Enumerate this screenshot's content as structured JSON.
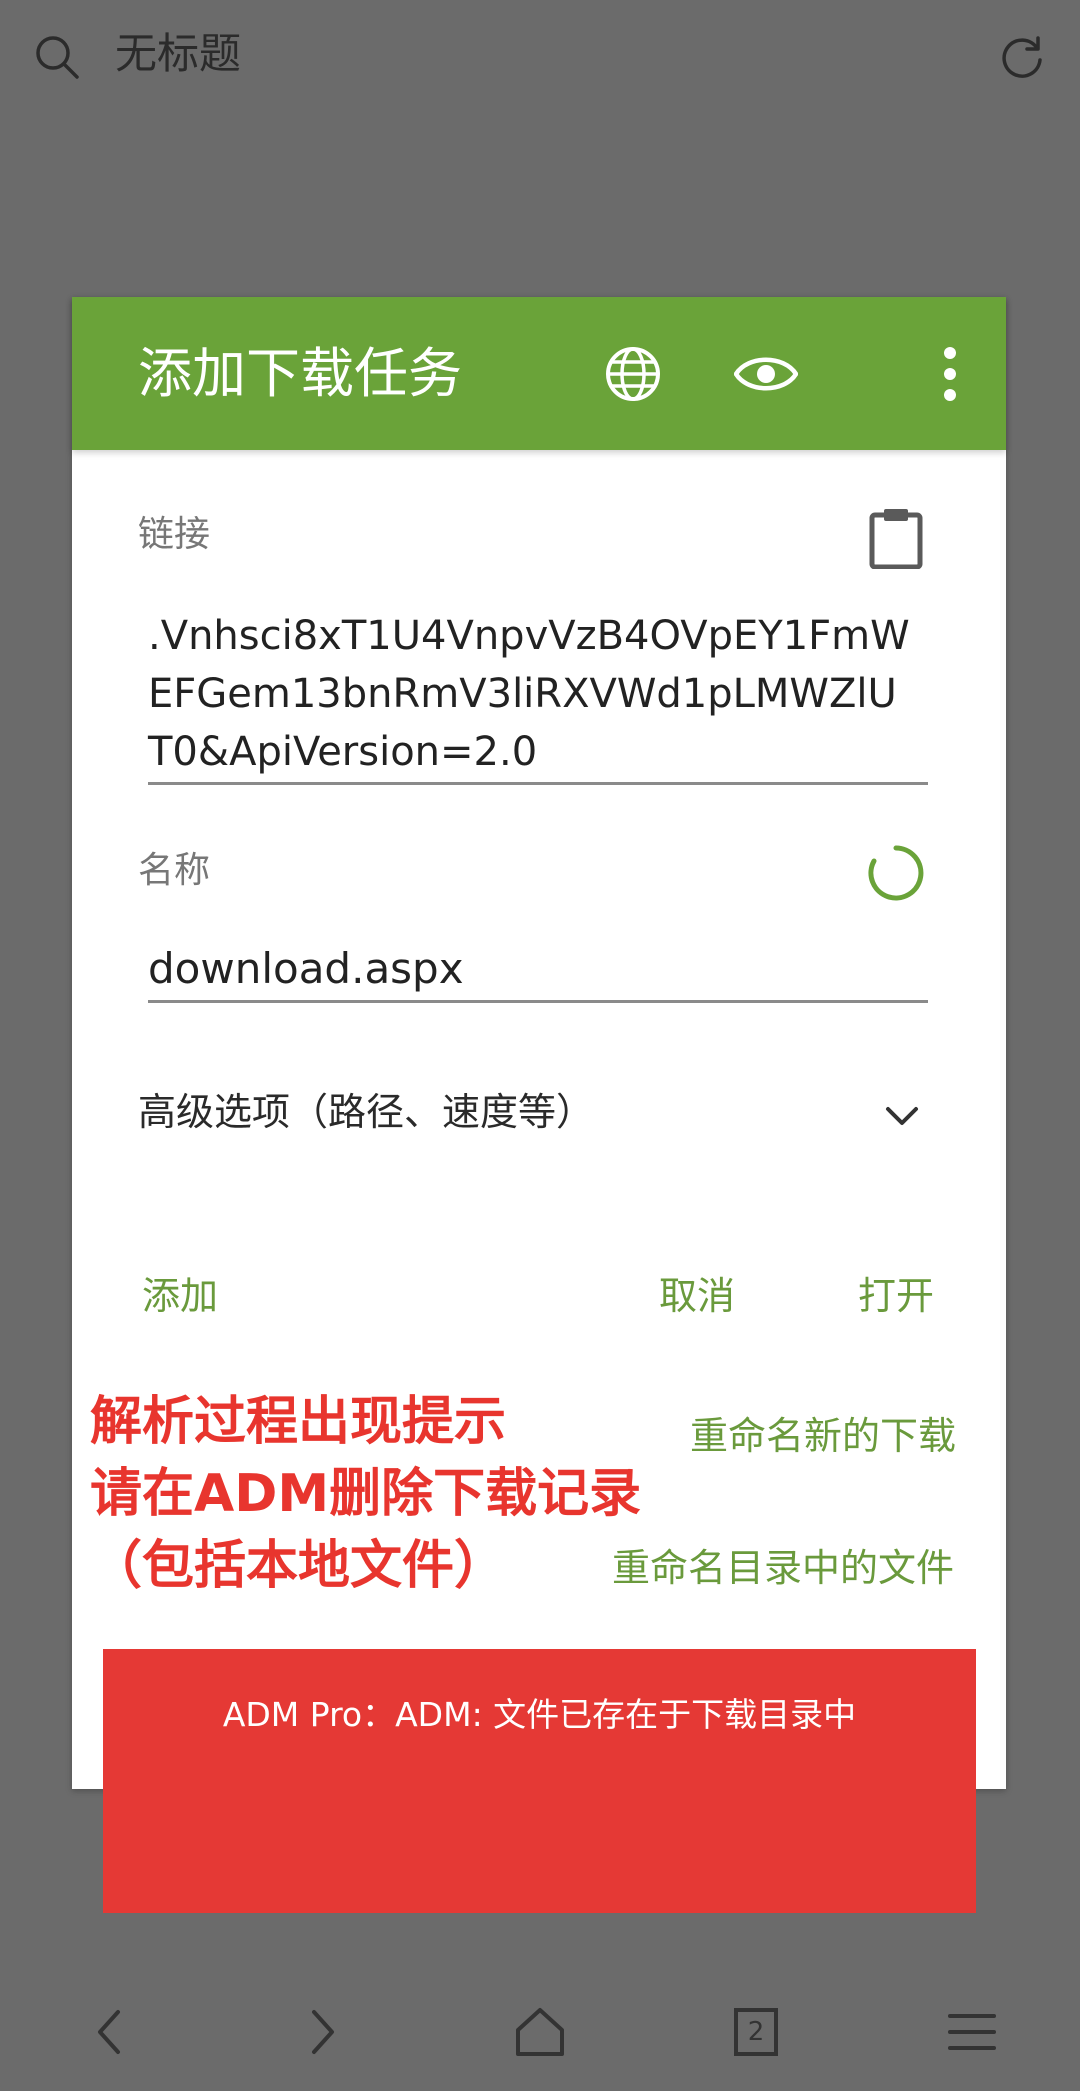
{
  "topbar": {
    "title": "无标题",
    "search_icon": "search-icon",
    "refresh_icon": "refresh-icon"
  },
  "dialog": {
    "title": "添加下载任务",
    "header_icons": [
      "globe-icon",
      "eye-icon",
      "more-vert-icon"
    ],
    "link_label": "链接",
    "link_value": ".Vnhsci8xT1U4VnpvVzB4OVpEY1FmWEFGem13bnRmV3liRXVWd1pLMWZlUT0&ApiVersion=2.0",
    "name_label": "名称",
    "name_value": "download.aspx",
    "advanced_label": "高级选项（路径、速度等）",
    "add_button": "添加",
    "cancel_button": "取消",
    "open_button": "打开"
  },
  "annotation": {
    "red_line1": "解析过程出现提示",
    "red_line2": "请在ADM删除下载记录",
    "red_line3": "（包括本地文件）",
    "rename_new": "重命名新的下载",
    "rename_existing": "重命名目录中的文件"
  },
  "toast": {
    "message": "ADM Pro：ADM: 文件已存在于下载目录中"
  },
  "navbar": {
    "tab_count": "2",
    "icons": [
      "back-icon",
      "forward-icon",
      "home-icon",
      "tabs-icon",
      "menu-icon"
    ]
  },
  "colors": {
    "accent_green": "#6aa339",
    "toast_red": "#e53935",
    "note_red": "#e8352e",
    "text_green": "#6a9a3c"
  }
}
